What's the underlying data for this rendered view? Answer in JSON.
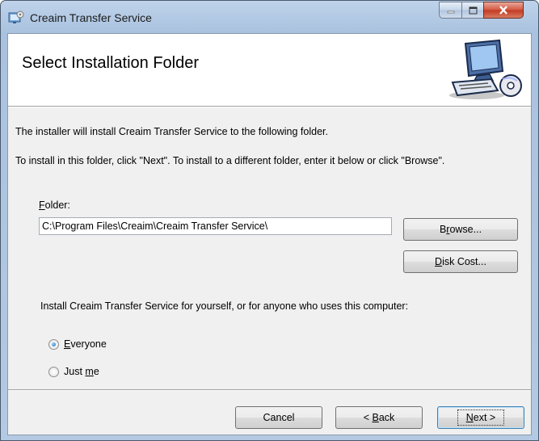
{
  "window": {
    "title": "Creaim Transfer Service"
  },
  "banner": {
    "title": "Select Installation Folder"
  },
  "body": {
    "intro": "The installer will install Creaim Transfer Service to the following folder.",
    "instructions": "To install in this folder, click \"Next\". To install to a different folder, enter it below or click \"Browse\".",
    "folder_label": "Folder:",
    "folder_value": "C:\\Program Files\\Creaim\\Creaim Transfer Service\\",
    "browse_label": "Browse...",
    "disk_cost_label": "Disk Cost...",
    "scope_prompt": "Install Creaim Transfer Service for yourself, or for anyone who uses this computer:",
    "options": [
      {
        "label": "Everyone",
        "selected": true
      },
      {
        "label": "Just me",
        "selected": false
      }
    ]
  },
  "footer": {
    "cancel_label": "Cancel",
    "back_label": "< Back",
    "next_label": "Next >"
  },
  "icons": {
    "app": "installer-icon",
    "banner": "computer-cd-icon",
    "minimize": "minimize-icon",
    "maximize": "maximize-icon",
    "close": "close-icon"
  }
}
